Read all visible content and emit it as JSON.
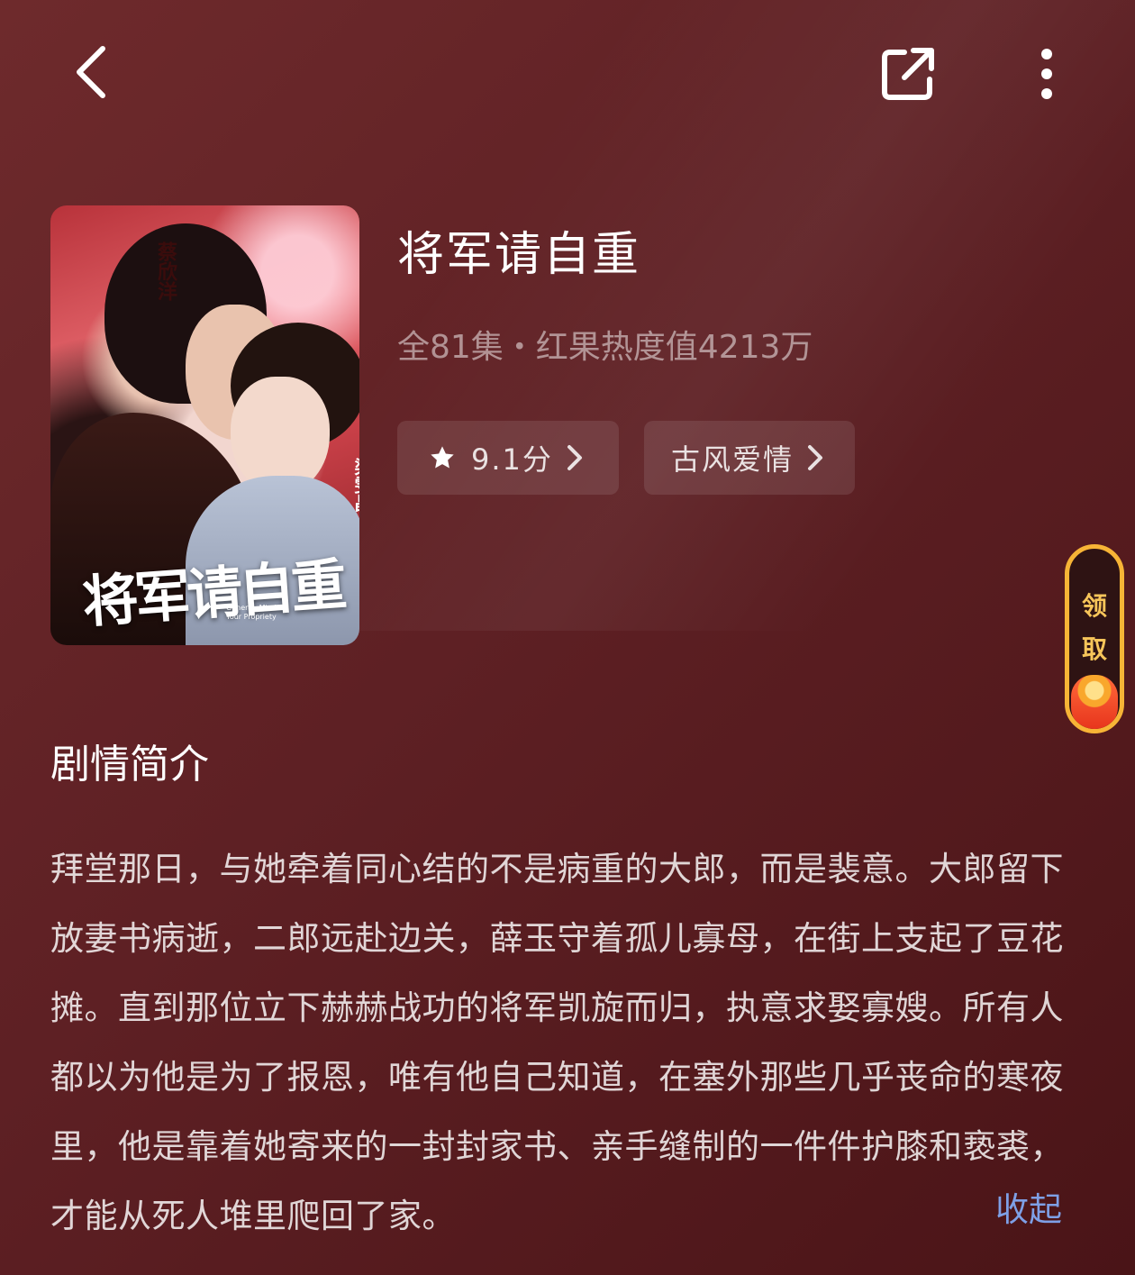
{
  "drama": {
    "title": "将军请自重",
    "meta": "全81集・红果热度值4213万",
    "rating_label": "9.1分",
    "genre_label": "古风爱情"
  },
  "poster": {
    "calligraphy_title": "将军请自重",
    "actor_1": "蔡欣洋",
    "actor_2": "梁雯晶",
    "english_title": "General, Mind Your Propriety"
  },
  "reward": {
    "line1": "领",
    "line2": "取"
  },
  "synopsis": {
    "heading": "剧情简介",
    "text": "拜堂那日，与她牵着同心结的不是病重的大郎，而是裴意。大郎留下放妻书病逝，二郎远赴边关，薛玉守着孤儿寡母，在街上支起了豆花摊。直到那位立下赫赫战功的将军凯旋而归，执意求娶寡嫂。所有人都以为他是为了报恩，唯有他自己知道，在塞外那些几乎丧命的寒夜里，他是靠着她寄来的一封封家书、亲手缝制的一件件护膝和亵裘，才能从死人堆里爬回了家。",
    "collapse_label": "收起"
  },
  "icons": [
    "back-icon",
    "share-icon",
    "more-icon",
    "star-icon",
    "chevron-right-icon",
    "red-envelope-icon"
  ],
  "colors": {
    "background": "#5e2024",
    "accent_link": "#7ea0e6",
    "reward_border": "#f7b436"
  }
}
